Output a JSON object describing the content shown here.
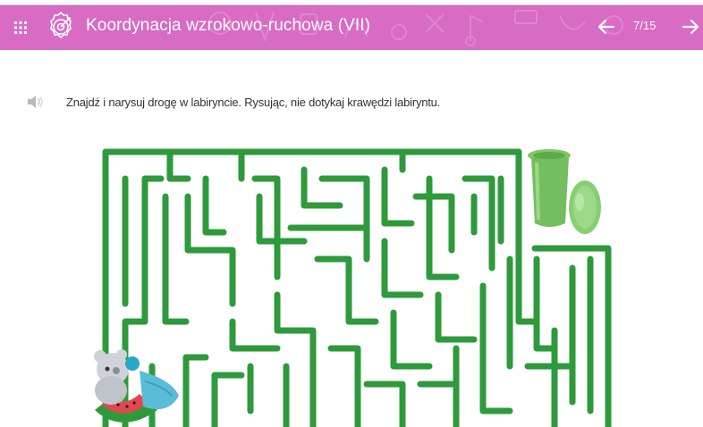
{
  "header": {
    "menu_icon": "grid-menu-icon",
    "logo_icon": "target-dart-icon",
    "title": "Koordynacja wzrokowo-ruchowa (VII)",
    "counter": "7/15",
    "prev_icon": "arrow-left-icon",
    "next_icon": "arrow-right-icon",
    "color": "#d86bc3"
  },
  "exercise": {
    "audio_icon": "speaker-icon",
    "instruction": "Znajdź i narysuj drogę w labiryncie. Rysując, nie dotykaj krawędzi labiryntu."
  },
  "maze": {
    "wall_color": "#2e9a3c",
    "goal_icon": "green-trash-bin-icon",
    "start_icon": "bear-with-watermelon-icon"
  }
}
